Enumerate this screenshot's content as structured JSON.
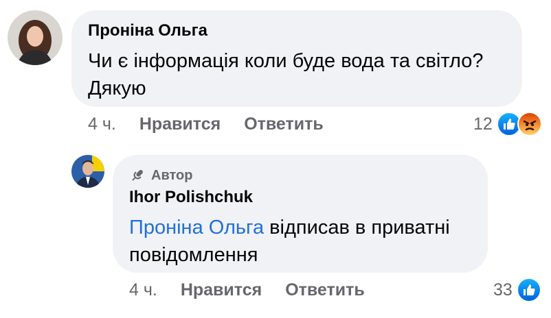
{
  "comment1": {
    "author": "Проніна Ольга",
    "text_line1": "Чи є інформація коли буде вода та світло?",
    "text_line2": "Дякую",
    "time": "4 ч.",
    "like_label": "Нравится",
    "reply_label": "Ответить",
    "reaction_count": "12",
    "reactions": [
      "like-icon",
      "angry-icon"
    ]
  },
  "comment2": {
    "badge": "Автор",
    "author": "Ihor Polishchuk",
    "mention": "Проніна Ольга",
    "text_rest": " відписав в приватні",
    "text_line2": "повідомлення",
    "time": "4 ч.",
    "like_label": "Нравится",
    "reply_label": "Ответить",
    "reaction_count": "33",
    "reactions": [
      "like-icon"
    ]
  },
  "colors": {
    "bubble": "#f0f2f5",
    "mention": "#216fdb",
    "meta": "#65676b",
    "like_blue": "#1877f2"
  }
}
